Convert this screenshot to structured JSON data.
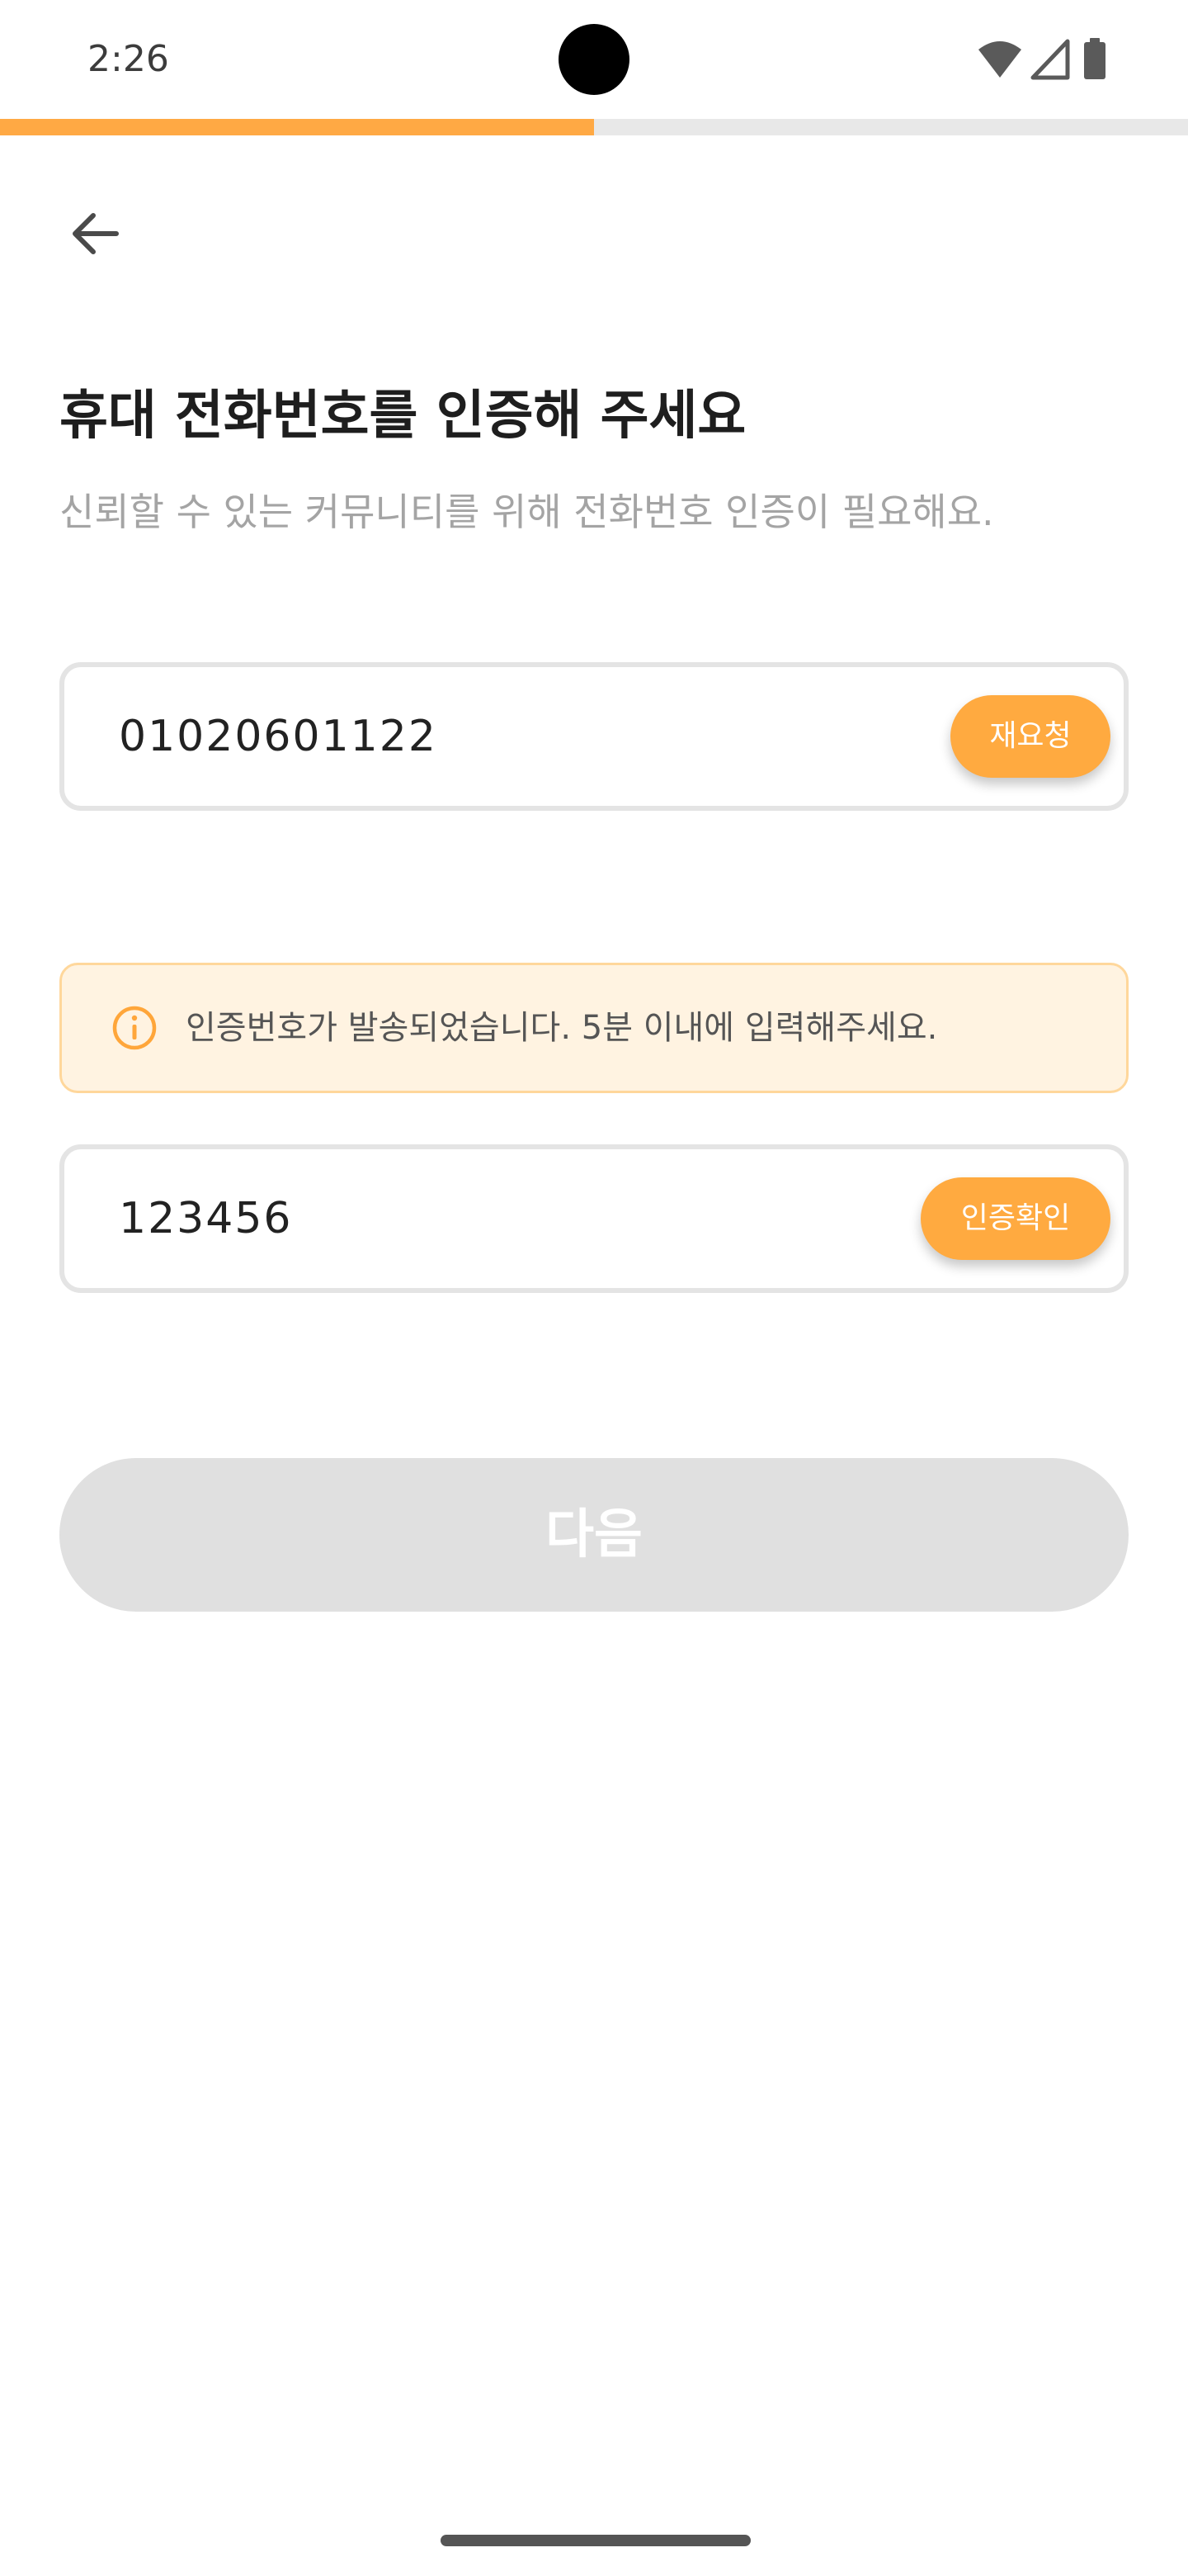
{
  "status_bar": {
    "time": "2:26",
    "icons": [
      "wifi-icon",
      "cellular-signal-icon",
      "battery-icon"
    ]
  },
  "progress": {
    "fraction": 0.5,
    "fill_color": "#ffa944",
    "track_color": "#e8e8e8"
  },
  "header": {
    "back_icon": "arrow-left-icon"
  },
  "content": {
    "title": "휴대 전화번호를 인증해 주세요",
    "subtitle": "신뢰할 수 있는 커뮤니티를 위해 전화번호 인증이 필요해요."
  },
  "phone_field": {
    "value": "01020601122",
    "action_label": "재요청"
  },
  "notice": {
    "icon": "info-circle-icon",
    "text": "인증번호가 발송되었습니다. 5분 이내에 입력해주세요."
  },
  "code_field": {
    "value": "123456",
    "action_label": "인증확인"
  },
  "next_button": {
    "label": "다음",
    "enabled": false
  },
  "colors": {
    "accent": "#ffaa40",
    "disabled": "#e0e0e0",
    "notice_bg": "#fff3e1",
    "notice_border": "#ffd79b"
  }
}
